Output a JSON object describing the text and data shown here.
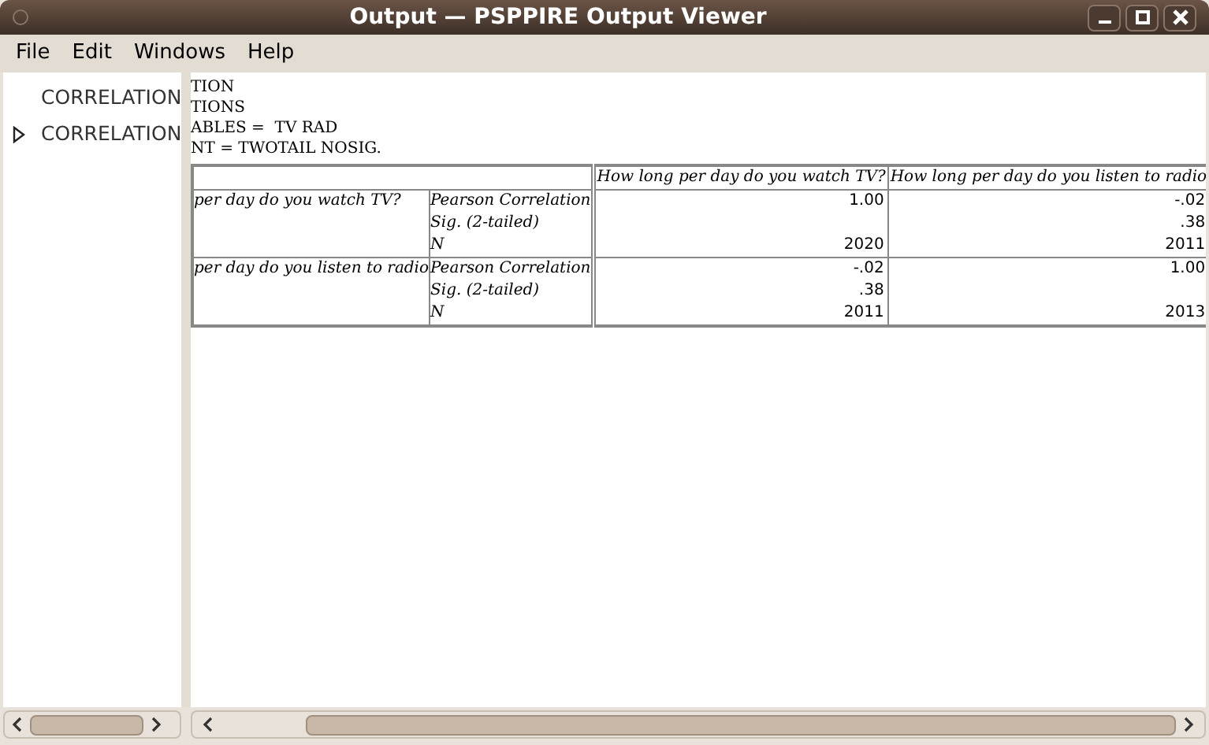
{
  "window": {
    "title": "Output — PSPPIRE Output Viewer"
  },
  "menu": [
    "File",
    "Edit",
    "Windows",
    "Help"
  ],
  "outline": [
    {
      "label": "CORRELATION"
    },
    {
      "label": "CORRELATION",
      "expanded": false
    }
  ],
  "syntax": [
    "TION",
    "TIONS",
    "ABLES =  TV RAD",
    "NT = TWOTAIL NOSIG."
  ],
  "table": {
    "columns": [
      "How long per day do you watch TV?",
      "How long per day do you listen to radio"
    ],
    "rows": [
      {
        "label": "per day do you watch TV?",
        "stats": [
          "Pearson Correlation",
          "Sig. (2-tailed)",
          "N"
        ],
        "values": [
          {
            "correlation": "1.00",
            "n": "2020"
          },
          {
            "correlation": "-.02",
            "sig": ".38",
            "n": "2011"
          }
        ]
      },
      {
        "label": "per day do you listen to radio",
        "stats": [
          "Pearson Correlation",
          "Sig. (2-tailed)",
          "N"
        ],
        "values": [
          {
            "correlation": "-.02",
            "sig": ".38",
            "n": "2011"
          },
          {
            "correlation": "1.00",
            "n": "2013"
          }
        ]
      }
    ]
  }
}
